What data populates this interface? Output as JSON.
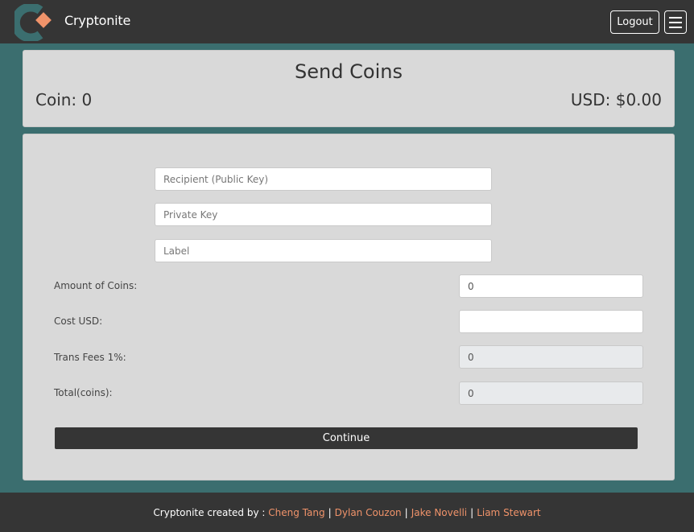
{
  "nav": {
    "brand": "Cryptonite",
    "logout_label": "Logout",
    "menu_icon": "hamburger-menu-icon",
    "logo_icon": "cryptonite-logo-icon",
    "logo_colors": {
      "ring": "#3b6e6f",
      "diamond": "#f0936a"
    }
  },
  "header": {
    "title": "Send Coins",
    "coin_balance": "Coin: 0",
    "usd_balance": "USD: $0.00"
  },
  "form": {
    "recipient_placeholder": "Recipient (Public Key)",
    "private_key_placeholder": "Private Key",
    "label_placeholder": "Label",
    "amount_label": "Amount of Coins:",
    "amount_value": "0",
    "cost_label": "Cost USD:",
    "cost_value": "",
    "fees_label": "Trans Fees 1%:",
    "fees_value": "0",
    "total_label": "Total(coins):",
    "total_value": "0",
    "continue_label": "Continue"
  },
  "footer": {
    "prefix": "Cryptonite created by :",
    "authors": [
      "Cheng Tang",
      "Dylan Couzon",
      "Jake Novelli",
      "Liam Stewart"
    ],
    "separator": "|"
  },
  "colors": {
    "page_background": "#3b6e6f",
    "navbar": "#353535",
    "card": "#d9d9d9",
    "accent": "#f0936a"
  }
}
